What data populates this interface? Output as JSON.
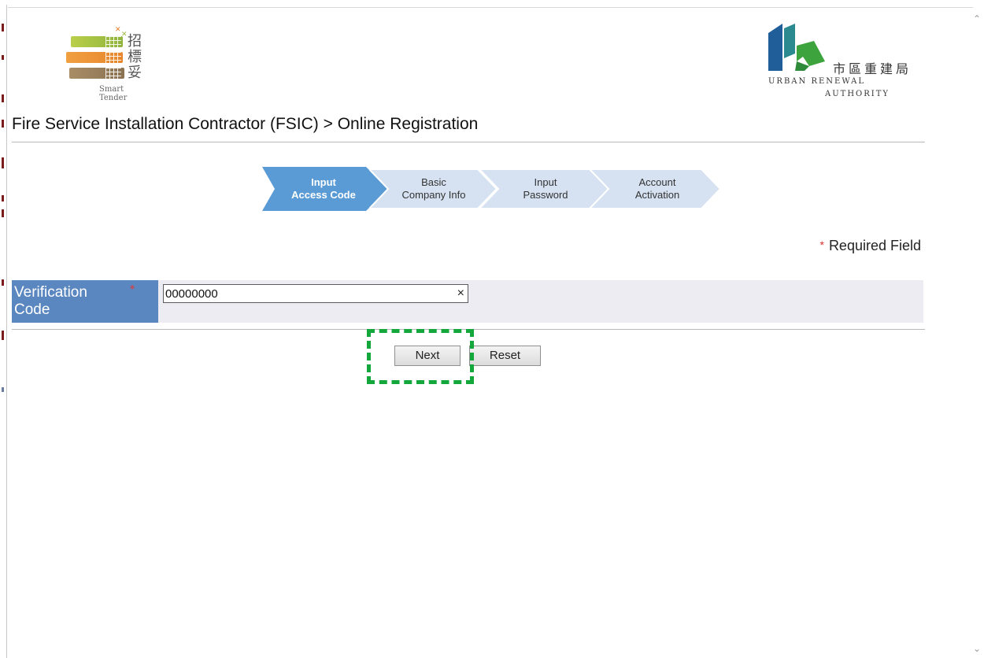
{
  "logos": {
    "smart_tender": {
      "chinese_chars": [
        "招",
        "標",
        "妥"
      ],
      "subtitle": "Smart Tender"
    },
    "ura": {
      "chinese": "市區重建局",
      "english_line1": "URBAN RENEWAL",
      "english_line2": "AUTHORITY",
      "colors": {
        "blue": "#1f5e99",
        "teal": "#2a8a8f",
        "green": "#3da33c"
      }
    }
  },
  "page": {
    "title": "Fire Service Installation Contractor (FSIC) > Online Registration"
  },
  "wizard": {
    "steps": [
      {
        "line1": "Input",
        "line2": "Access Code",
        "active": true
      },
      {
        "line1": "Basic",
        "line2": "Company Info",
        "active": false
      },
      {
        "line1": "Input",
        "line2": "Password",
        "active": false
      },
      {
        "line1": "Account",
        "line2": "Activation",
        "active": false
      }
    ],
    "colors": {
      "active": "#5b9bd5",
      "inactive": "#d6e2f1"
    }
  },
  "required_note": {
    "asterisk": "*",
    "text": "Required Field"
  },
  "form": {
    "label_line1": "Verification",
    "label_line2": "Code",
    "required_mark": "*",
    "value": "00000000",
    "clear_icon": "×"
  },
  "buttons": {
    "next": "Next",
    "reset": "Reset"
  },
  "colors": {
    "label_bg": "#5b87c0",
    "row_bg": "#ececf2",
    "highlight": "#14a83c",
    "asterisk": "#d9322a"
  }
}
